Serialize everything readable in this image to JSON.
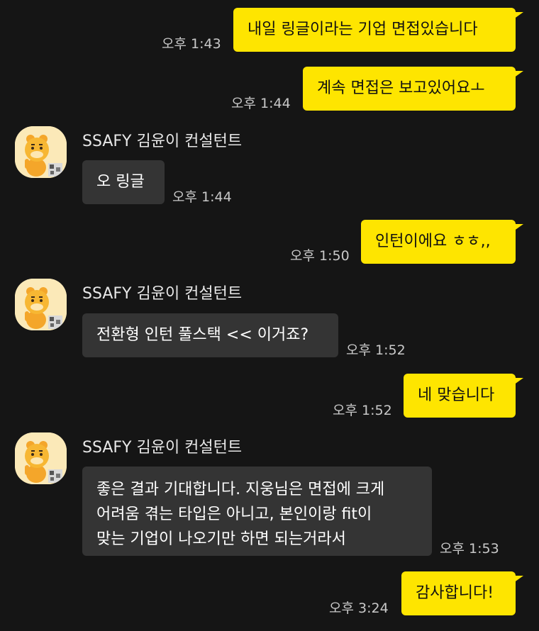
{
  "messages": [
    {
      "id": "m1",
      "from": "me",
      "text": "내일 링글이라는 기업 면접있습니다",
      "time": "오후 1:43"
    },
    {
      "id": "m2",
      "from": "me",
      "text": "계속 면접은 보고있어요ㅗ",
      "time": "오후 1:44"
    },
    {
      "id": "m3",
      "from": "other",
      "sender": "SSAFY 김윤이 컨설턴트",
      "text": "오 링글",
      "time": "오후 1:44"
    },
    {
      "id": "m4",
      "from": "me",
      "text": "인턴이에요 ㅎㅎ,,",
      "time": "오후 1:50"
    },
    {
      "id": "m5",
      "from": "other",
      "sender": "SSAFY 김윤이 컨설턴트",
      "text": "전환형 인턴 풀스택 << 이거죠?",
      "time": "오후 1:52"
    },
    {
      "id": "m6",
      "from": "me",
      "text": "네 맞습니다",
      "time": "오후 1:52"
    },
    {
      "id": "m7",
      "from": "other",
      "sender": "SSAFY 김윤이 컨설턴트",
      "lines": [
        "좋은 결과 기대합니다. 지웅님은 면접에 크게",
        "어려움 겪는 타입은 아니고, 본인이랑 fit이",
        "맞는 기업이 나오기만 하면 되는거라서"
      ],
      "time": "오후 1:53"
    },
    {
      "id": "m8",
      "from": "me",
      "text": "감사합니다!",
      "time": "오후 3:24"
    }
  ],
  "colors": {
    "background": "#151515",
    "my_bubble": "#fee500",
    "their_bubble": "#343434",
    "time_text": "#c9c9c9"
  }
}
